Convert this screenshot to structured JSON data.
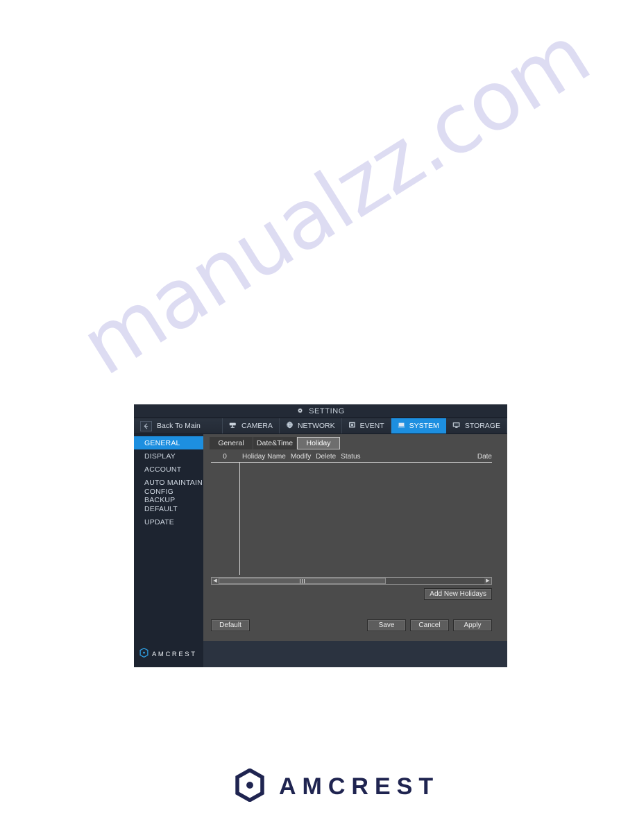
{
  "page": {
    "watermark_text": "manualzz.com",
    "brand_name": "AMCREST",
    "brand_icon": "amcrest-hexagon-logo",
    "background_color": "#ffffff"
  },
  "dialog": {
    "title": "SETTING",
    "title_icon": "gear-icon",
    "colors": {
      "chrome": "#232a36",
      "sidebar": "#1d2430",
      "content": "#4b4b4b",
      "accent": "#1d8fe0",
      "footer": "#2b3340"
    },
    "nav": {
      "back_label": "Back To Main",
      "back_icon": "back-arrow-icon",
      "tabs": [
        {
          "label": "CAMERA",
          "icon": "camera-icon",
          "active": false
        },
        {
          "label": "NETWORK",
          "icon": "globe-icon",
          "active": false
        },
        {
          "label": "EVENT",
          "icon": "event-icon",
          "active": false
        },
        {
          "label": "SYSTEM",
          "icon": "system-icon",
          "active": true
        },
        {
          "label": "STORAGE",
          "icon": "storage-icon",
          "active": false
        }
      ]
    },
    "sidebar": {
      "items": [
        {
          "label": "GENERAL",
          "active": true
        },
        {
          "label": "DISPLAY",
          "active": false
        },
        {
          "label": "ACCOUNT",
          "active": false
        },
        {
          "label": "AUTO MAINTAIN",
          "active": false
        },
        {
          "label": "CONFIG BACKUP",
          "active": false
        },
        {
          "label": "DEFAULT",
          "active": false
        },
        {
          "label": "UPDATE",
          "active": false
        }
      ]
    },
    "subtabs": [
      {
        "label": "General",
        "active": false
      },
      {
        "label": "Date&Time",
        "active": false
      },
      {
        "label": "Holiday",
        "active": true
      }
    ],
    "table": {
      "index_header": "0",
      "headers": [
        "Holiday Name",
        "Modify",
        "Delete",
        "Status"
      ],
      "trailing_header": "Date",
      "rows": []
    },
    "scrollbar": {
      "left_arrow_icon": "scroll-left-arrow-icon",
      "right_arrow_icon": "scroll-right-arrow-icon",
      "thumb_position": "0%",
      "thumb_width": "63%"
    },
    "buttons": {
      "add_new_holidays": "Add New Holidays",
      "default": "Default",
      "save": "Save",
      "cancel": "Cancel",
      "apply": "Apply"
    },
    "footer": {
      "brand": "AMCREST",
      "brand_icon": "amcrest-hexagon-logo"
    }
  }
}
